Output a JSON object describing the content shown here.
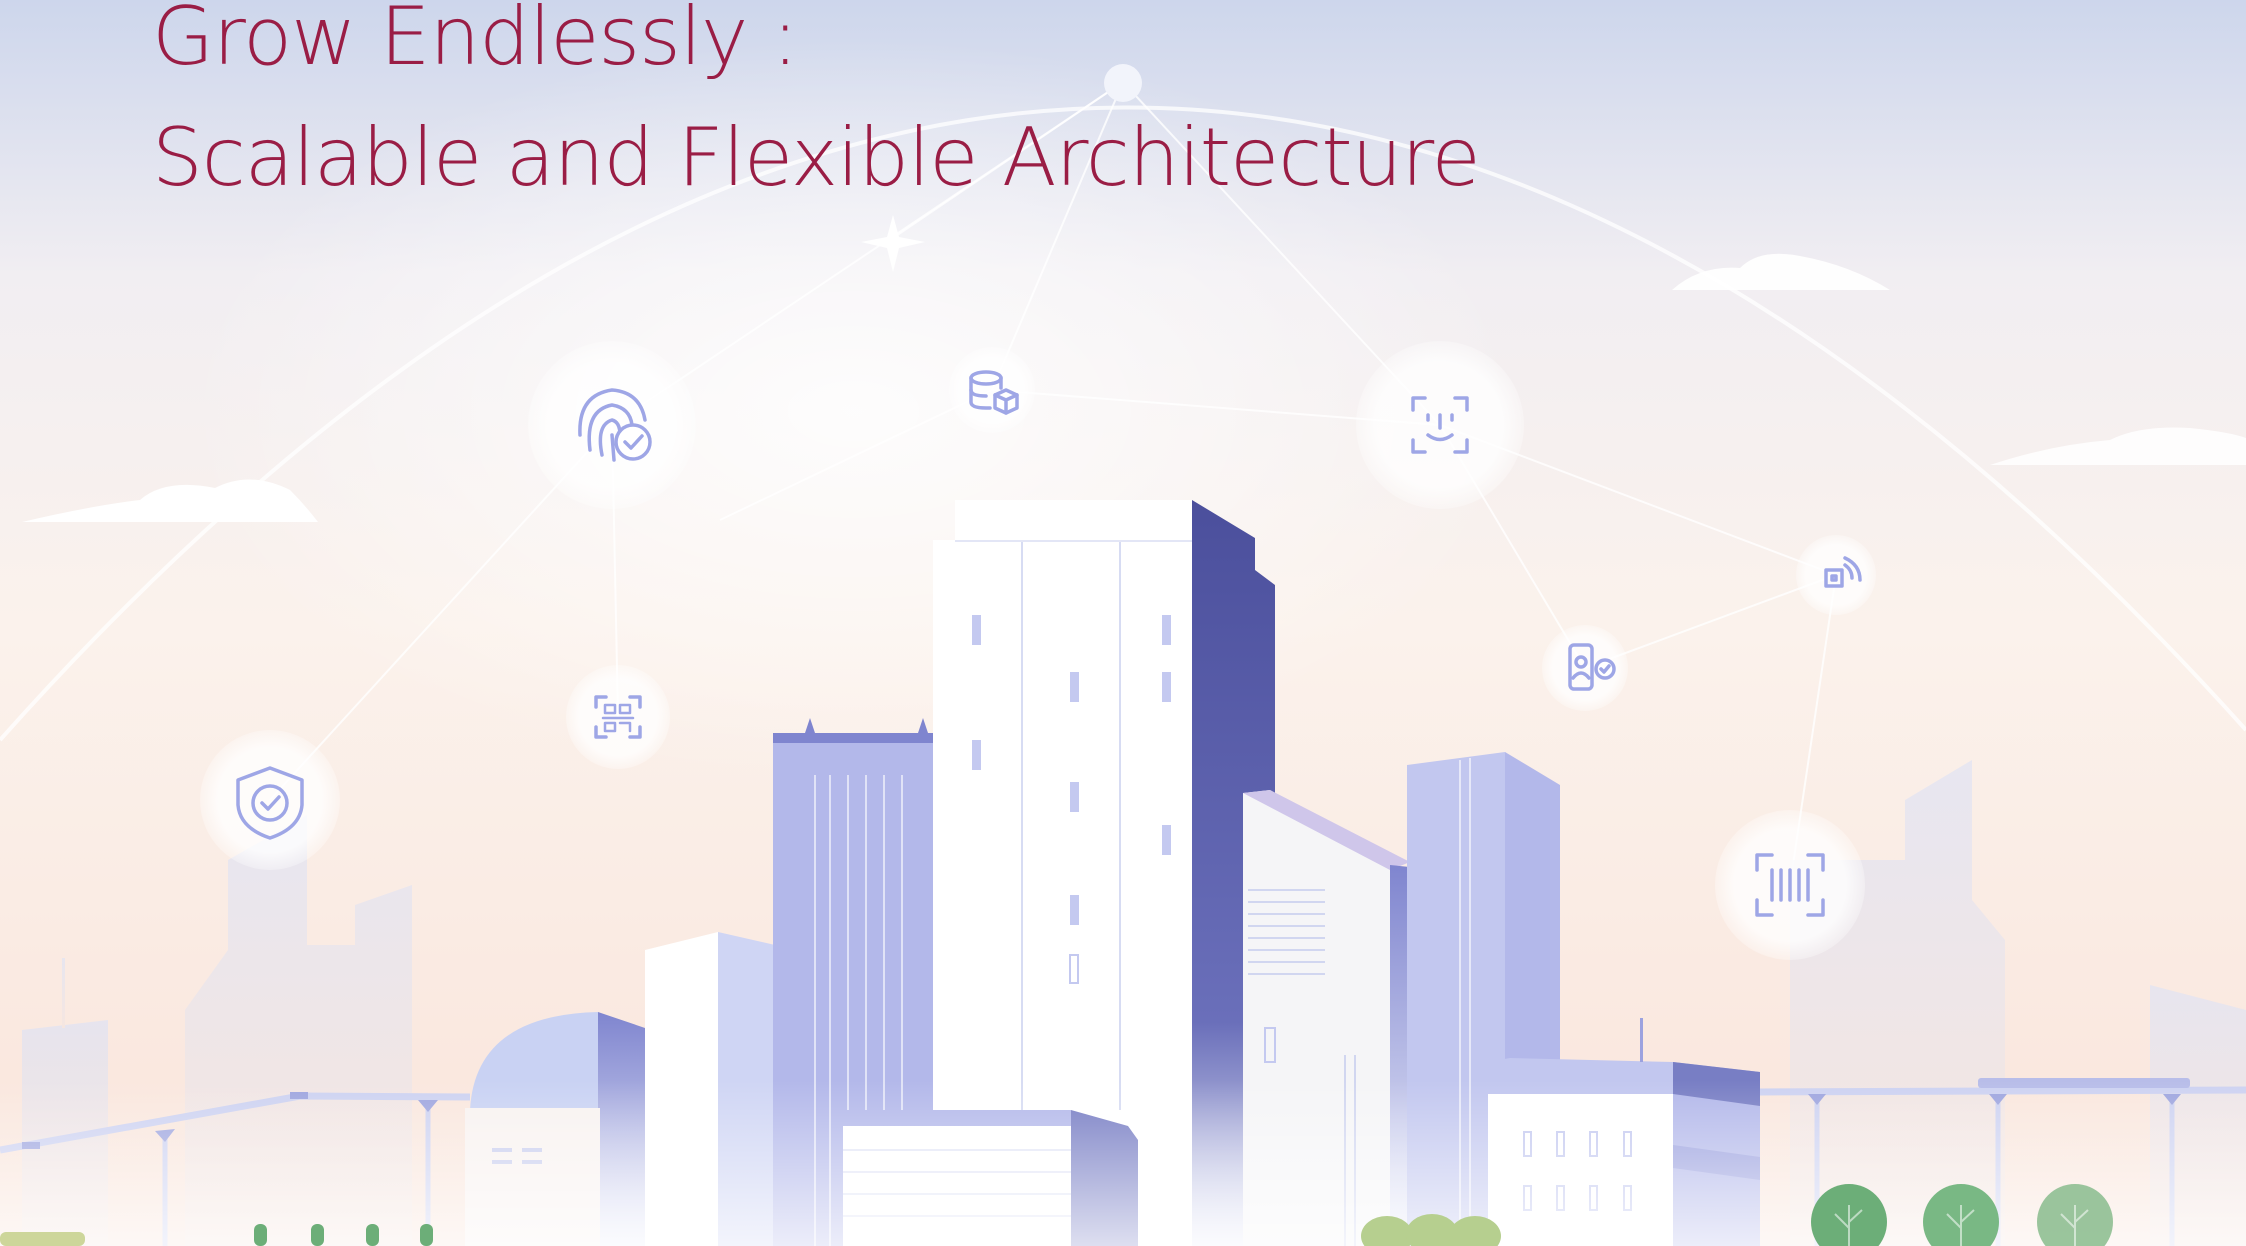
{
  "heading": {
    "line1": "Grow Endlessly :",
    "line2": "Scalable and Flexible Architecture"
  },
  "colors": {
    "heading": "#9a1d45",
    "sky_top": "#cdd6ec",
    "sky_mid": "#f7ece6",
    "building_dark": "#4b4f9c",
    "building_mid": "#7f85cf",
    "building_light": "#b3b8ea",
    "icon_stroke": "#9ea6e6",
    "tree": "#6cae78"
  },
  "icons": [
    "fingerprint-check-icon",
    "database-box-icon",
    "face-scan-icon",
    "nfc-tap-icon",
    "phone-user-check-icon",
    "qr-code-icon",
    "shield-check-icon",
    "barcode-scan-icon"
  ]
}
